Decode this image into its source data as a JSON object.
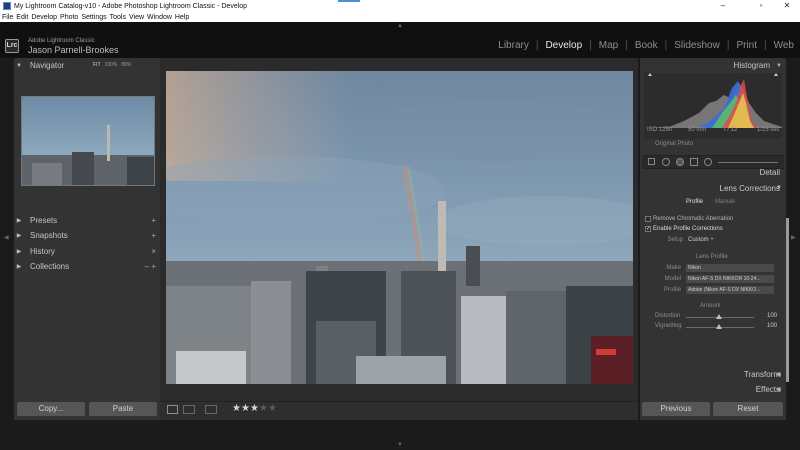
{
  "window": {
    "title": "My Lightroom Catalog-v10 - Adobe Photoshop Lightroom Classic - Develop",
    "minimize": "–",
    "maximize": "▫",
    "close": "✕"
  },
  "menu": [
    "File",
    "Edit",
    "Develop",
    "Photo",
    "Settings",
    "Tools",
    "View",
    "Window",
    "Help"
  ],
  "identity": {
    "badge": "Lrc",
    "app_name": "Adobe Lightroom Classic",
    "user": "Jason Parnell-Brookes"
  },
  "modules": {
    "items": [
      "Library",
      "Develop",
      "Map",
      "Book",
      "Slideshow",
      "Print",
      "Web"
    ],
    "active": "Develop",
    "separator": "|"
  },
  "left_panel": {
    "navigator": {
      "title": "Navigator",
      "zoom": [
        "FIT",
        "100%",
        "88%"
      ]
    },
    "presets": {
      "title": "Presets",
      "action": "+"
    },
    "snapshots": {
      "title": "Snapshots",
      "action": "+"
    },
    "history": {
      "title": "History",
      "action": "×"
    },
    "collections": {
      "title": "Collections",
      "action": "– +"
    },
    "copy_label": "Copy...",
    "paste_label": "Paste"
  },
  "toolbar": {
    "rating": 3,
    "rating_max": 5
  },
  "right_panel": {
    "histogram": {
      "title": "Histogram",
      "iso": "ISO 1250",
      "focal": "50 mm",
      "aperture": "f / 12",
      "shutter": "1/25 sec",
      "original_label": "Original Photo"
    },
    "detail_title": "Detail",
    "lens_corrections": {
      "title": "Lens Corrections",
      "tabs": [
        "Profile",
        "Manual"
      ],
      "active_tab": "Profile",
      "remove_ca": "Remove Chromatic Aberration",
      "remove_ca_checked": false,
      "enable_profile": "Enable Profile Corrections",
      "enable_profile_checked": true,
      "setup_label": "Setup",
      "setup_value": "Custom ÷",
      "lens_profile_title": "Lens Profile",
      "make_label": "Make",
      "make_value": "Nikon",
      "model_label": "Model",
      "model_value": "Nikon AF-S DX NIKKOR 10-24...",
      "profile_label": "Profile",
      "profile_value": "Adobe (Nikon AF-S DX NIKKO...",
      "amount_title": "Amount",
      "distortion_label": "Distortion",
      "distortion_value": "100",
      "vignetting_label": "Vignetting",
      "vignetting_value": "100"
    },
    "transform_title": "Transform",
    "effects_title": "Effects",
    "previous_label": "Previous",
    "reset_label": "Reset"
  },
  "colors": {
    "panel": "#333333",
    "background": "#1b1b1b",
    "button": "#565656",
    "active_module": "#e6e6e6"
  }
}
